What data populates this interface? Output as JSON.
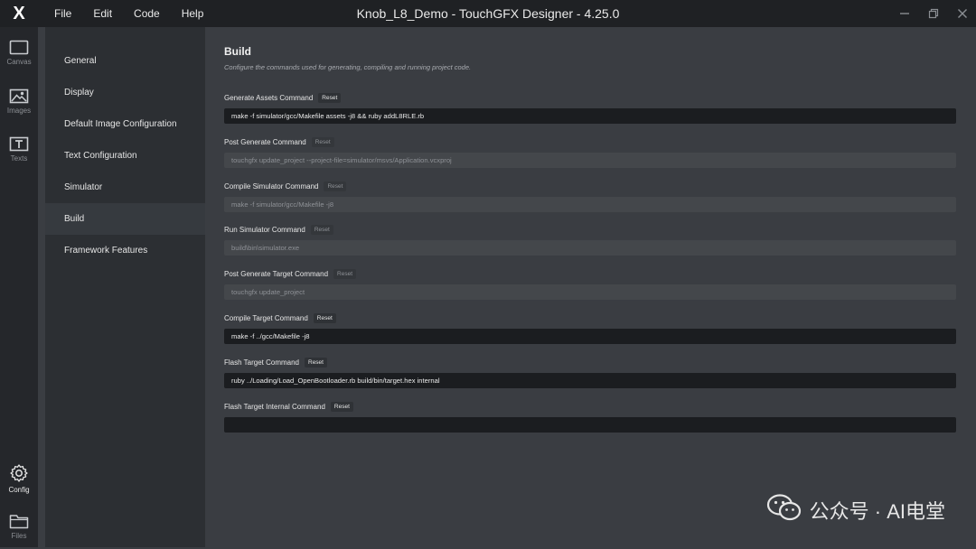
{
  "titlebar": {
    "logo": "X",
    "menu": [
      "File",
      "Edit",
      "Code",
      "Help"
    ],
    "title": "Knob_L8_Demo - TouchGFX Designer - 4.25.0"
  },
  "rail": {
    "items": [
      {
        "label": "Canvas",
        "icon": "canvas-icon"
      },
      {
        "label": "Images",
        "icon": "image-icon"
      },
      {
        "label": "Texts",
        "icon": "text-icon"
      },
      {
        "label": "Config",
        "icon": "gear-icon"
      },
      {
        "label": "Files",
        "icon": "folder-icon"
      }
    ]
  },
  "nav": {
    "items": [
      "General",
      "Display",
      "Default Image Configuration",
      "Text Configuration",
      "Simulator",
      "Build",
      "Framework Features"
    ],
    "active": "Build"
  },
  "build": {
    "title": "Build",
    "description": "Configure the commands used for generating, compiling and running project code.",
    "reset_label": "Reset",
    "fields": [
      {
        "label": "Generate Assets Command",
        "value": "make -f simulator/gcc/Makefile assets -j8 && ruby addL8RLE.rb",
        "state": "active"
      },
      {
        "label": "Post Generate Command",
        "value": "touchgfx update_project --project-file=simulator/msvs/Application.vcxproj",
        "state": "muted"
      },
      {
        "label": "Compile Simulator Command",
        "value": "make -f simulator/gcc/Makefile -j8",
        "state": "muted"
      },
      {
        "label": "Run Simulator Command",
        "value": "build\\bin\\simulator.exe",
        "state": "muted"
      },
      {
        "label": "Post Generate Target Command",
        "value": "touchgfx update_project",
        "state": "muted"
      },
      {
        "label": "Compile Target Command",
        "value": "make -f ../gcc/Makefile -j8",
        "state": "active"
      },
      {
        "label": "Flash Target Command",
        "value": "ruby ../Loading/Load_OpenBootloader.rb build/bin/target.hex internal",
        "state": "active"
      },
      {
        "label": "Flash Target Internal Command",
        "value": "",
        "state": "active"
      }
    ]
  },
  "watermark": {
    "text": "公众号 · AI电堂"
  }
}
